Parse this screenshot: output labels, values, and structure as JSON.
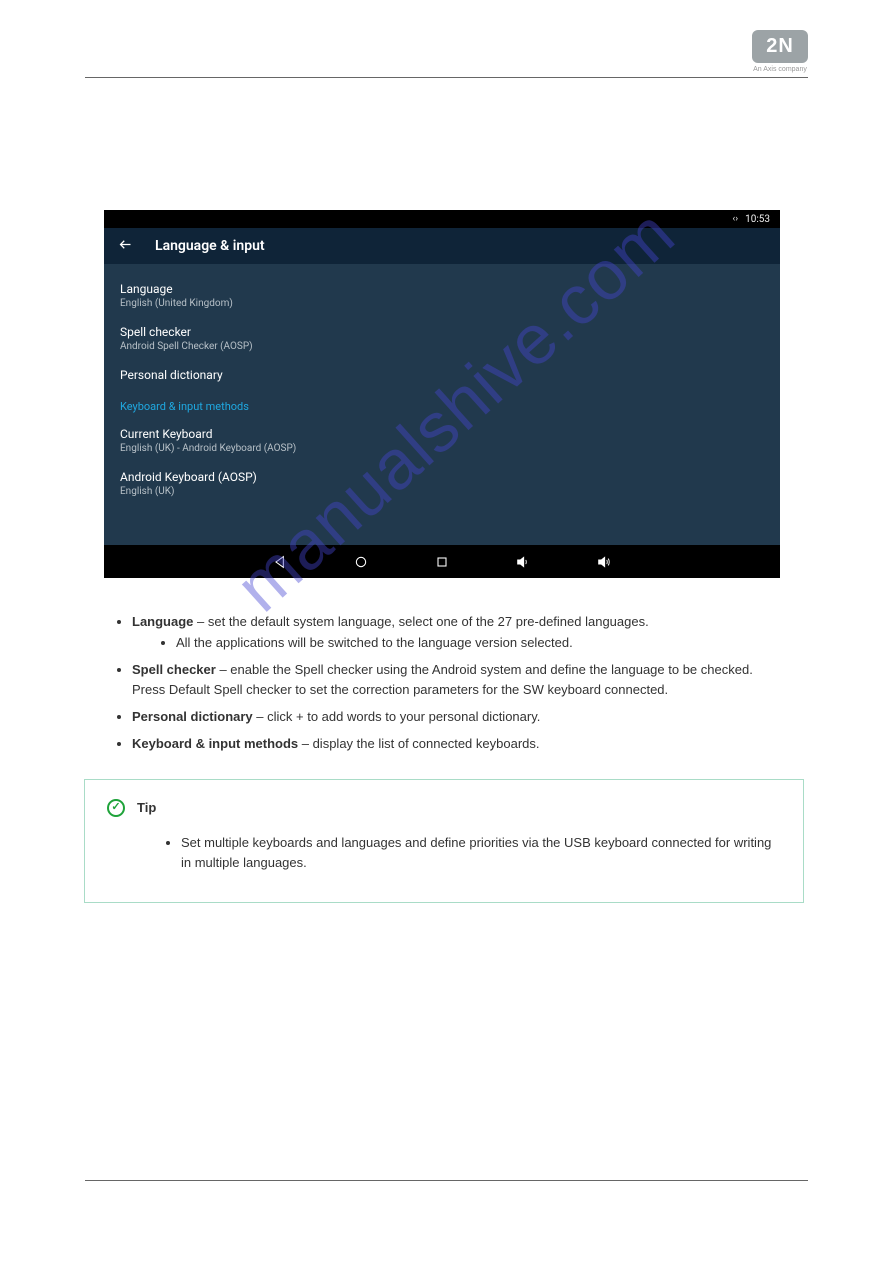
{
  "logo": {
    "text": "2N",
    "tagline": "An Axis company"
  },
  "watermark": "manualshive.com",
  "device": {
    "status": {
      "arrows": "‹ ›",
      "time": "10:53"
    },
    "appbar": {
      "title": "Language & input"
    },
    "items": [
      {
        "title": "Language",
        "sub": "English (United Kingdom)"
      },
      {
        "title": "Spell checker",
        "sub": "Android Spell Checker (AOSP)"
      },
      {
        "title": "Personal dictionary",
        "sub": ""
      }
    ],
    "section": "Keyboard & input methods",
    "items2": [
      {
        "title": "Current Keyboard",
        "sub": "English (UK) - Android Keyboard (AOSP)"
      },
      {
        "title": "Android Keyboard (AOSP)",
        "sub": "English (UK)"
      }
    ]
  },
  "bullets": {
    "b1_label": "Language",
    "b1_text": " – set the default system language, select one of the 27 pre-defined languages.",
    "b1a": "All the applications will be switched to the language version selected.",
    "b2_label": "Spell checker",
    "b2_text": " – enable the Spell checker using the Android system and define the language to be checked. Press Default Spell checker to set the correction parameters for the SW keyboard connected.",
    "b3_label": "Personal dictionary",
    "b3_text": " – click + to add words to your personal dictionary.",
    "b4_label": "Keyboard & input methods",
    "b4_text": " – display the list of connected keyboards."
  },
  "tip": {
    "title": "Tip",
    "body": "Set multiple keyboards and languages and define priorities via the USB keyboard connected for writing in multiple languages."
  }
}
